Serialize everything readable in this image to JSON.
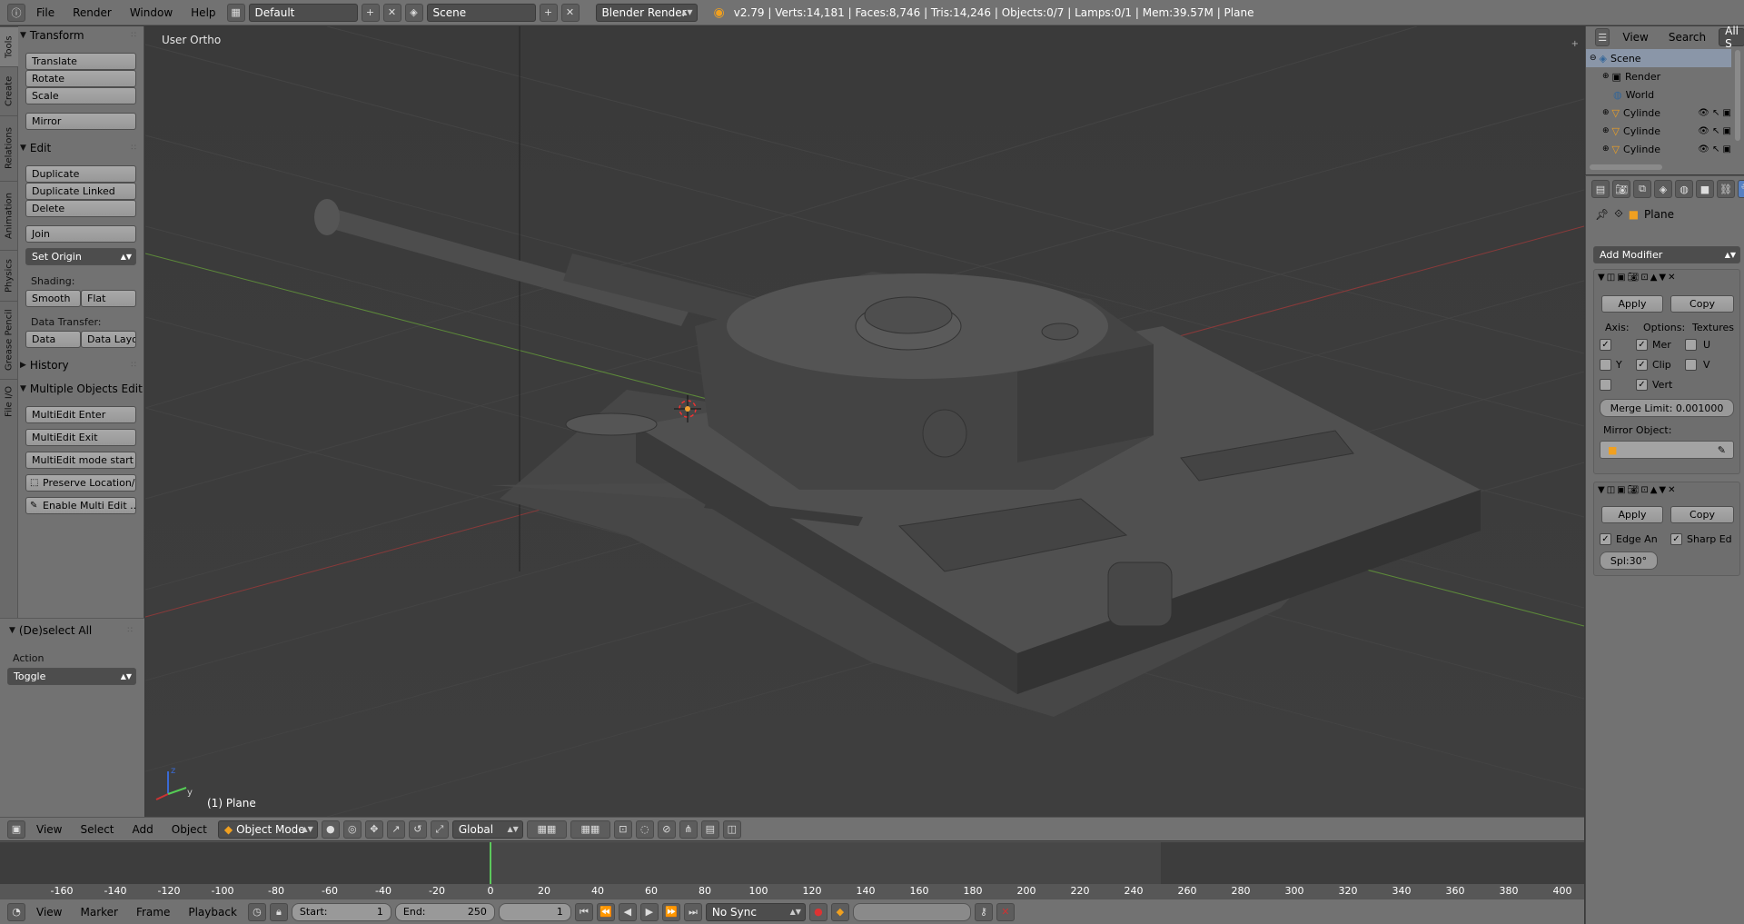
{
  "topbar": {
    "menus": [
      "File",
      "Render",
      "Window",
      "Help"
    ],
    "layout": "Default",
    "scene": "Scene",
    "engine": "Blender Render",
    "info": "v2.79 | Verts:14,181 | Faces:8,746 | Tris:14,246 | Objects:0/7 | Lamps:0/1 | Mem:39.57M | Plane"
  },
  "toolshelf": {
    "tabs": [
      "Tools",
      "Create",
      "Relations",
      "Animation",
      "Physics",
      "Grease Pencil",
      "File I/O"
    ],
    "transform": {
      "title": "Transform",
      "translate": "Translate",
      "rotate": "Rotate",
      "scale": "Scale",
      "mirror": "Mirror"
    },
    "edit": {
      "title": "Edit",
      "duplicate": "Duplicate",
      "duplicate_linked": "Duplicate Linked",
      "delete": "Delete",
      "join": "Join",
      "set_origin": "Set Origin",
      "shading_label": "Shading:",
      "smooth": "Smooth",
      "flat": "Flat",
      "data_transfer_label": "Data Transfer:",
      "data": "Data",
      "data_layout": "Data Layo"
    },
    "history": {
      "title": "History"
    },
    "multi": {
      "title": "Multiple Objects Edit",
      "enter": "MultiEdit Enter",
      "exit": "MultiEdit Exit",
      "mode_start": "MultiEdit mode start",
      "preserve": "Preserve Location/...",
      "enable": "Enable Multi Edit ..."
    },
    "deselect": {
      "title": "(De)select All",
      "action_label": "Action",
      "action_value": "Toggle"
    }
  },
  "viewport": {
    "view_label": "User Ortho",
    "object_label": "(1) Plane"
  },
  "viewheader": {
    "menus": [
      "View",
      "Select",
      "Add",
      "Object"
    ],
    "mode": "Object Mode",
    "orientation": "Global"
  },
  "timeline": {
    "ticks": [
      "-160",
      "-140",
      "-120",
      "-100",
      "-80",
      "-60",
      "-40",
      "-20",
      "0",
      "20",
      "40",
      "60",
      "80",
      "100",
      "120",
      "140",
      "160",
      "180",
      "200",
      "220",
      "240",
      "260",
      "280",
      "300",
      "320",
      "340",
      "360",
      "380",
      "400"
    ],
    "current_frame": 0
  },
  "tlheader": {
    "menus": [
      "View",
      "Marker",
      "Frame",
      "Playback"
    ],
    "start_label": "Start:",
    "start_value": "1",
    "end_label": "End:",
    "end_value": "250",
    "current": "1",
    "sync": "No Sync"
  },
  "outliner": {
    "menus": [
      "View",
      "Search",
      "All S"
    ],
    "items": [
      "Scene",
      "Render",
      "World",
      "Cylinde",
      "Cylinde",
      "Cylinde"
    ]
  },
  "props": {
    "object_name": "Plane",
    "add_modifier": "Add Modifier",
    "mirror": {
      "apply": "Apply",
      "copy": "Copy",
      "axis_label": "Axis:",
      "options_label": "Options:",
      "textures_label": "Textures",
      "merge": "Mer",
      "clip": "Clip",
      "vert": "Vert",
      "y": "Y",
      "u": "U",
      "v": "V",
      "merge_limit": "Merge Limit: 0.001000",
      "mirror_object_label": "Mirror Object:"
    },
    "edgesplit": {
      "apply": "Apply",
      "copy": "Copy",
      "edge_angle": "Edge An",
      "sharp_edges": "Sharp Ed",
      "split_angle": "Spl:30°"
    }
  }
}
